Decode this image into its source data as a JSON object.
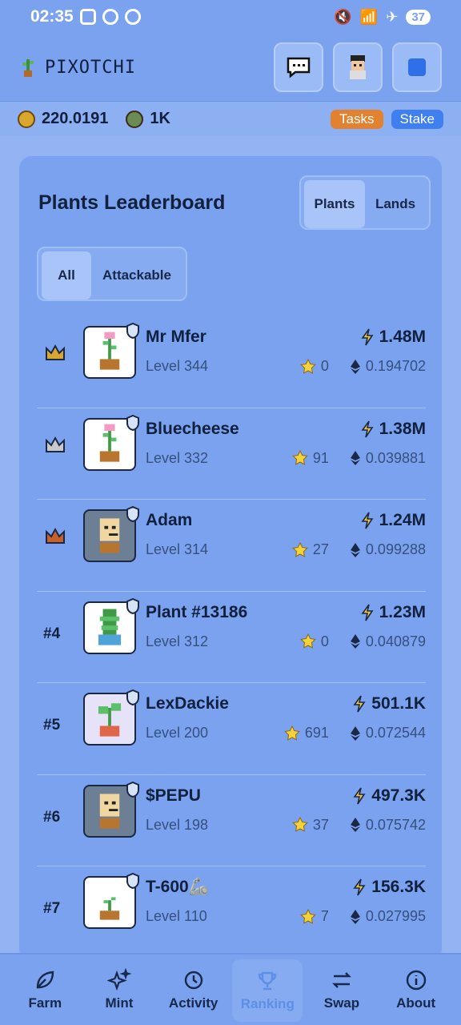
{
  "status_bar": {
    "time": "02:35",
    "battery": "37"
  },
  "header": {
    "title": "PIXOTCHI",
    "chat_icon": "chat-icon",
    "avatar_icon": "avatar-icon",
    "square_icon": "stop-icon"
  },
  "balances": {
    "token_amount": "220.0191",
    "plant_count": "1K",
    "tasks_label": "Tasks",
    "stake_label": "Stake"
  },
  "leaderboard": {
    "title": "Plants Leaderboard",
    "tabs": [
      {
        "label": "Plants",
        "active": true
      },
      {
        "label": "Lands",
        "active": false
      }
    ],
    "filters": [
      {
        "label": "All",
        "active": true
      },
      {
        "label": "Attackable",
        "active": false
      }
    ],
    "rows": [
      {
        "rank": "1",
        "name": "Mr Mfer",
        "level": "Level 344",
        "power": "1.48M",
        "stars": "0",
        "eth": "0.194702",
        "crown_color": "#d9a72d"
      },
      {
        "rank": "2",
        "name": "Bluecheese",
        "level": "Level 332",
        "power": "1.38M",
        "stars": "91",
        "eth": "0.039881",
        "crown_color": "#c9c9c9"
      },
      {
        "rank": "3",
        "name": "Adam",
        "level": "Level 314",
        "power": "1.24M",
        "stars": "27",
        "eth": "0.099288",
        "crown_color": "#c8602a"
      },
      {
        "rank": "#4",
        "name": "Plant #13186",
        "level": "Level 312",
        "power": "1.23M",
        "stars": "0",
        "eth": "0.040879"
      },
      {
        "rank": "#5",
        "name": "LexDackie",
        "level": "Level 200",
        "power": "501.1K",
        "stars": "691",
        "eth": "0.072544"
      },
      {
        "rank": "#6",
        "name": "$PEPU",
        "level": "Level 198",
        "power": "497.3K",
        "stars": "37",
        "eth": "0.075742"
      },
      {
        "rank": "#7",
        "name": "T-600🦾",
        "level": "Level 110",
        "power": "156.3K",
        "stars": "7",
        "eth": "0.027995"
      }
    ]
  },
  "nav": [
    {
      "label": "Farm",
      "icon": "leaf-icon",
      "active": false
    },
    {
      "label": "Mint",
      "icon": "sparkle-icon",
      "active": false
    },
    {
      "label": "Activity",
      "icon": "history-icon",
      "active": false
    },
    {
      "label": "Ranking",
      "icon": "trophy-icon",
      "active": true
    },
    {
      "label": "Swap",
      "icon": "swap-icon",
      "active": false
    },
    {
      "label": "About",
      "icon": "info-icon",
      "active": false
    }
  ]
}
